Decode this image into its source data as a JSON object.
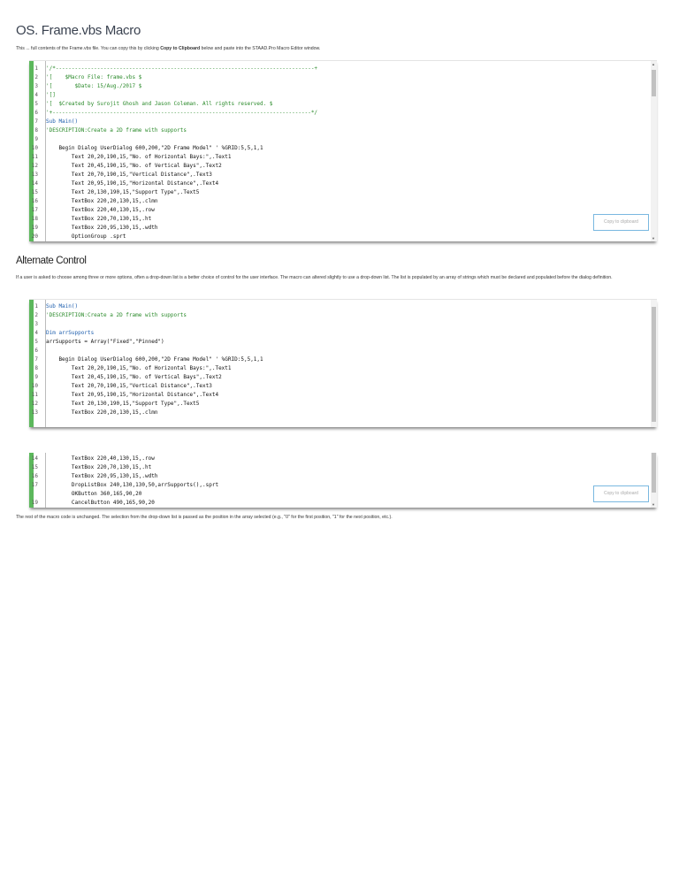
{
  "title": "OS. Frame.vbs Macro",
  "intro": "This ... full contents of the Frame.vbs file. You can copy this by clicking ",
  "intro_bold": "Copy to Clipboard",
  "intro_end": " below and paste into the STAAD.Pro Macro Editor window.",
  "copy_label": "Copy to clipboard",
  "code1": [
    [
      "1",
      "'/*---------------------------------------------------------------------------------+"
    ],
    [
      "2",
      "'[    $Macro File: frame.vbs $"
    ],
    [
      "3",
      "'[       $Date: 15/Aug./2017 $"
    ],
    [
      "4",
      "'[]"
    ],
    [
      "5",
      "'[  $Created by Surojit Ghosh and Jason Coleman. All rights reserved. $"
    ],
    [
      "6",
      "'+---------------------------------------------------------------------------------*/"
    ],
    [
      "7",
      "Sub Main()"
    ],
    [
      "8",
      "'DESCRIPTION:Create a 2D frame with supports"
    ],
    [
      "9",
      ""
    ],
    [
      "10",
      "    Begin Dialog UserDialog 600,200,\"2D Frame Model\" ' %GRID:5,5,1,1"
    ],
    [
      "11",
      "        Text 20,20,190,15,\"No. of Horizontal Bays:\",.Text1"
    ],
    [
      "12",
      "        Text 20,45,190,15,\"No. of Vertical Bays\",.Text2"
    ],
    [
      "13",
      "        Text 20,70,190,15,\"Vertical Distance\",.Text3"
    ],
    [
      "14",
      "        Text 20,95,190,15,\"Horizontal Distance\",.Text4"
    ],
    [
      "15",
      "        Text 20,130,190,15,\"Support Type\",.Text5"
    ],
    [
      "16",
      "        TextBox 220,20,130,15,.clmn"
    ],
    [
      "17",
      "        TextBox 220,40,130,15,.row"
    ],
    [
      "18",
      "        TextBox 220,70,130,15,.ht"
    ],
    [
      "19",
      "        TextBox 220,95,130,15,.wdth"
    ],
    [
      "20",
      "        OptionGroup .sprt"
    ]
  ],
  "section2_title": "Alternate Control",
  "section2_text": "If a user is asked to choose among three or more options, often a drop-down list is a better choice of control for the user interface. The macro can altered slightly to use a drop-down list. The list is populated by an array of strings which must be declared and populated before the dialog definition.",
  "code2": [
    [
      "1",
      "Sub Main()"
    ],
    [
      "2",
      "'DESCRIPTION:Create a 2D frame with supports"
    ],
    [
      "3",
      ""
    ],
    [
      "4",
      "Dim arrSupports"
    ],
    [
      "5",
      "arrSupports = Array(\"Fixed\",\"Pinned\")"
    ],
    [
      "6",
      ""
    ],
    [
      "7",
      "    Begin Dialog UserDialog 600,200,\"2D Frame Model\" ' %GRID:5,5,1,1"
    ],
    [
      "8",
      "        Text 20,20,190,15,\"No. of Horizontal Bays:\",.Text1"
    ],
    [
      "9",
      "        Text 20,45,190,15,\"No. of Vertical Bays\",.Text2"
    ],
    [
      "10",
      "        Text 20,70,190,15,\"Vertical Distance\",.Text3"
    ],
    [
      "11",
      "        Text 20,95,190,15,\"Horizontal Distance\",.Text4"
    ],
    [
      "12",
      "        Text 20,130,190,15,\"Support Type\",.Text5"
    ],
    [
      "13",
      "        TextBox 220,20,130,15,.clmn"
    ]
  ],
  "code3": [
    [
      "14",
      "        TextBox 220,40,130,15,.row"
    ],
    [
      "15",
      "        TextBox 220,70,130,15,.ht"
    ],
    [
      "16",
      "        TextBox 220,95,130,15,.wdth"
    ],
    [
      "17",
      "        DropListBox 240,130,130,50,arrSupports(),.sprt"
    ],
    [
      "",
      "        OKButton 360,165,90,20"
    ],
    [
      "19",
      "        CancelButton 490,165,90,20"
    ]
  ],
  "footer_text": "The rest of the macro code is unchanged. The selection from the drop-down list is passed as the position in the array selected (e.g., \"0\" for the first position, \"1\" for the next position, etc.)."
}
